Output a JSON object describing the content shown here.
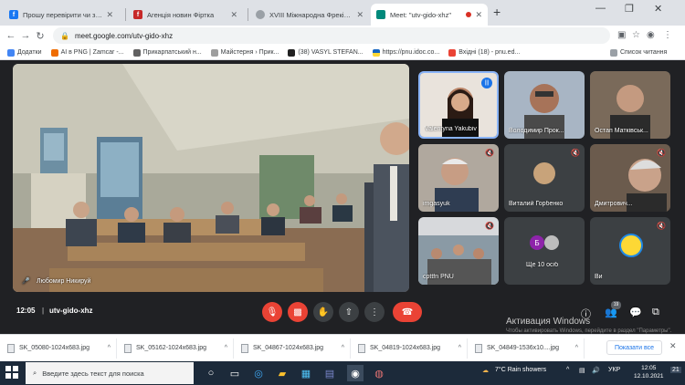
{
  "tabs": [
    {
      "title": "Прошу перевірити чи змінилась"
    },
    {
      "title": "Агенція новин Фіртка"
    },
    {
      "title": "XVIII Міжнародна Фреківська кон"
    },
    {
      "title": "Meet: \"utv-gido-xhz\""
    }
  ],
  "address_bar": {
    "url": "meet.google.com/utv-gido-xhz"
  },
  "bookmarks": [
    "Додатки",
    "AI в PNG | Zamсar -...",
    "Прикарпатський н...",
    "Майстерня › Прик...",
    "(38) VASYL STEFAN...",
    "https://pnu.idoc.co...",
    "Вхідні (18) - pnu.ed..."
  ],
  "reading_list": "Список читання",
  "meet": {
    "main_tile_name": "Любомир Никируй",
    "participants": [
      {
        "name": "Valentyna Yakubiv",
        "muted": false
      },
      {
        "name": "Володимир Прок...",
        "muted": false
      },
      {
        "name": "Остап Матківськ...",
        "muted": false
      },
      {
        "name": "imgasyuk",
        "muted": true
      },
      {
        "name": "Виталий Горбенко",
        "muted": true
      },
      {
        "name": "Дмитрович...",
        "muted": true
      },
      {
        "name": "cpttfn PNU",
        "muted": false
      },
      {
        "name": "Ще 10 осіб",
        "muted": false,
        "avatar_letter": "Б"
      },
      {
        "name": "Ви",
        "muted": true
      }
    ],
    "clock": "12:05",
    "meeting_code": "utv-gido-xhz",
    "people_count": "19"
  },
  "watermark": {
    "line1": "Активация Windows",
    "line2": "Чтобы активировать Windows, перейдите в раздел \"Параметры\"."
  },
  "downloads": [
    {
      "file": "SK_05080-1024x683.jpg"
    },
    {
      "file": "SK_05162-1024x683.jpg"
    },
    {
      "file": "SK_04867-1024x683.jpg"
    },
    {
      "file": "SK_04819-1024x683.jpg"
    },
    {
      "file": "SK_04849-1536x10....jpg"
    }
  ],
  "show_all_label": "Показати все",
  "taskbar": {
    "search_placeholder": "Введите здесь текст для поиска",
    "weather": "7°C  Rain showers",
    "lang": "УКР",
    "time": "12:05",
    "date": "12.10.2021",
    "notif_count": "21"
  }
}
